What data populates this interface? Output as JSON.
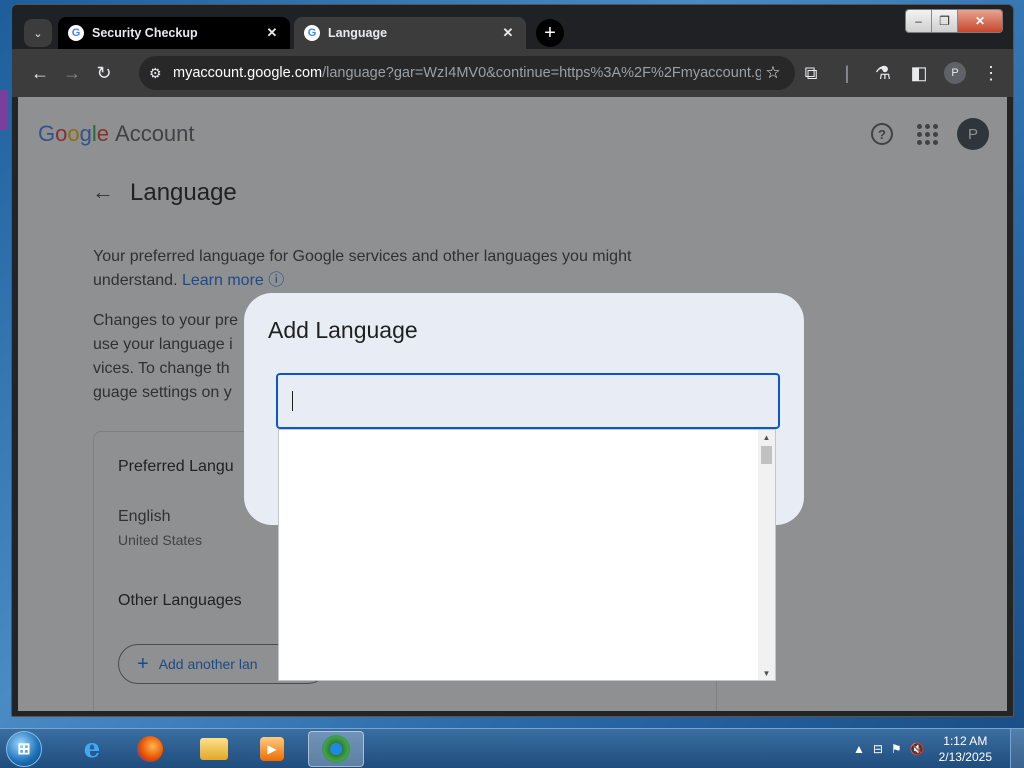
{
  "browser": {
    "tabs": [
      {
        "title": "Security Checkup",
        "active": false
      },
      {
        "title": "Language",
        "active": true
      }
    ],
    "url_host": "myaccount.google.com",
    "url_rest": "/language?gar=WzI4MV0&continue=https%3A%2F%2Fmyaccount.g...",
    "profile_initial": "P",
    "window_controls": {
      "minimize": "–",
      "restore": "❐",
      "close": "✕"
    }
  },
  "page": {
    "logo_word": "Google",
    "logo_account": "Account",
    "avatar_initial": "P",
    "title": "Language",
    "intro_text": "Your preferred language for Google services and other languages you might understand.",
    "learn_more": "Learn more",
    "changes_text": "Changes to your pre use your language i vices. To change th guage settings on y",
    "preferred_title": "Preferred Langu",
    "preferred_language": "English",
    "preferred_region": "United States",
    "other_title": "Other Languages",
    "add_button": "Add another lan"
  },
  "dialog": {
    "title": "Add Language",
    "input_value": "",
    "input_placeholder": ""
  },
  "taskbar": {
    "start": "⊞",
    "time": "1:12 AM",
    "date": "2/13/2025"
  },
  "colors": {
    "accent": "#0b57d0",
    "link": "#1a73e8",
    "dialog_bg": "#e8edf5"
  }
}
